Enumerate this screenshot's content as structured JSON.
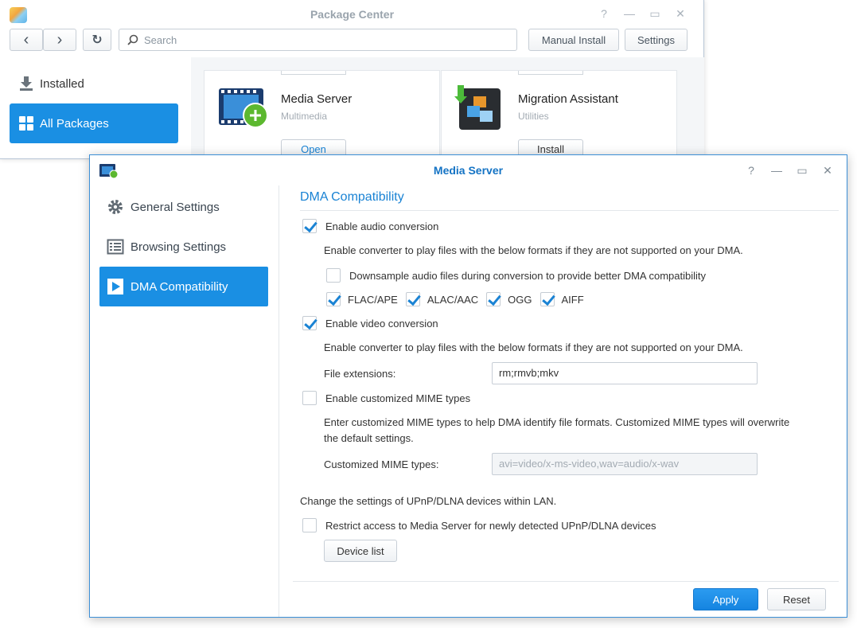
{
  "package_center": {
    "title": "Package Center",
    "toolbar": {
      "back_label": "‹",
      "forward_label": "›",
      "refresh_label": "↻",
      "search_placeholder": "Search",
      "manual_install_label": "Manual Install",
      "settings_label": "Settings"
    },
    "sidebar": {
      "items": [
        {
          "label": "Installed"
        },
        {
          "label": "All Packages"
        }
      ]
    },
    "packages": [
      {
        "name": "Media Server",
        "category": "Multimedia",
        "button": "Open"
      },
      {
        "name": "Migration Assistant",
        "category": "Utilities",
        "button": "Install"
      }
    ]
  },
  "media_server": {
    "title": "Media Server",
    "sidebar": {
      "items": [
        {
          "label": "General Settings"
        },
        {
          "label": "Browsing Settings"
        },
        {
          "label": "DMA Compatibility"
        }
      ]
    },
    "section_title": "DMA Compatibility",
    "audio": {
      "enable_label": "Enable audio conversion",
      "enabled": true,
      "description": "Enable converter to play files with the below formats if they are not supported on your DMA.",
      "downsample_label": "Downsample audio files during conversion to provide better DMA compatibility",
      "downsample_checked": false,
      "formats": [
        {
          "label": "FLAC/APE",
          "checked": true
        },
        {
          "label": "ALAC/AAC",
          "checked": true
        },
        {
          "label": "OGG",
          "checked": true
        },
        {
          "label": "AIFF",
          "checked": true
        }
      ]
    },
    "video": {
      "enable_label": "Enable video conversion",
      "enabled": true,
      "description": "Enable converter to play files with the below formats if they are not supported on your DMA.",
      "file_ext_label": "File extensions:",
      "file_ext_value": "rm;rmvb;mkv"
    },
    "mime": {
      "enable_label": "Enable customized MIME types",
      "enabled": false,
      "description_line1": "Enter customized MIME types to help DMA identify file formats. Customized MIME types will overwrite",
      "description_line2": "the default settings.",
      "types_label": "Customized MIME types:",
      "types_value": "avi=video/x-ms-video,wav=audio/x-wav"
    },
    "upnp": {
      "description": "Change the settings of UPnP/DLNA devices within LAN.",
      "restrict_label": "Restrict access to Media Server for newly detected UPnP/DLNA devices",
      "restrict_checked": false,
      "device_list_label": "Device list"
    },
    "footer": {
      "apply_label": "Apply",
      "reset_label": "Reset"
    }
  },
  "window_controls": {
    "help": "?",
    "minimize": "—",
    "maximize": "▭",
    "close": "✕"
  },
  "colors": {
    "accent": "#1a8fe3",
    "title_blue": "#1473c4",
    "check_blue": "#1a83d4"
  }
}
